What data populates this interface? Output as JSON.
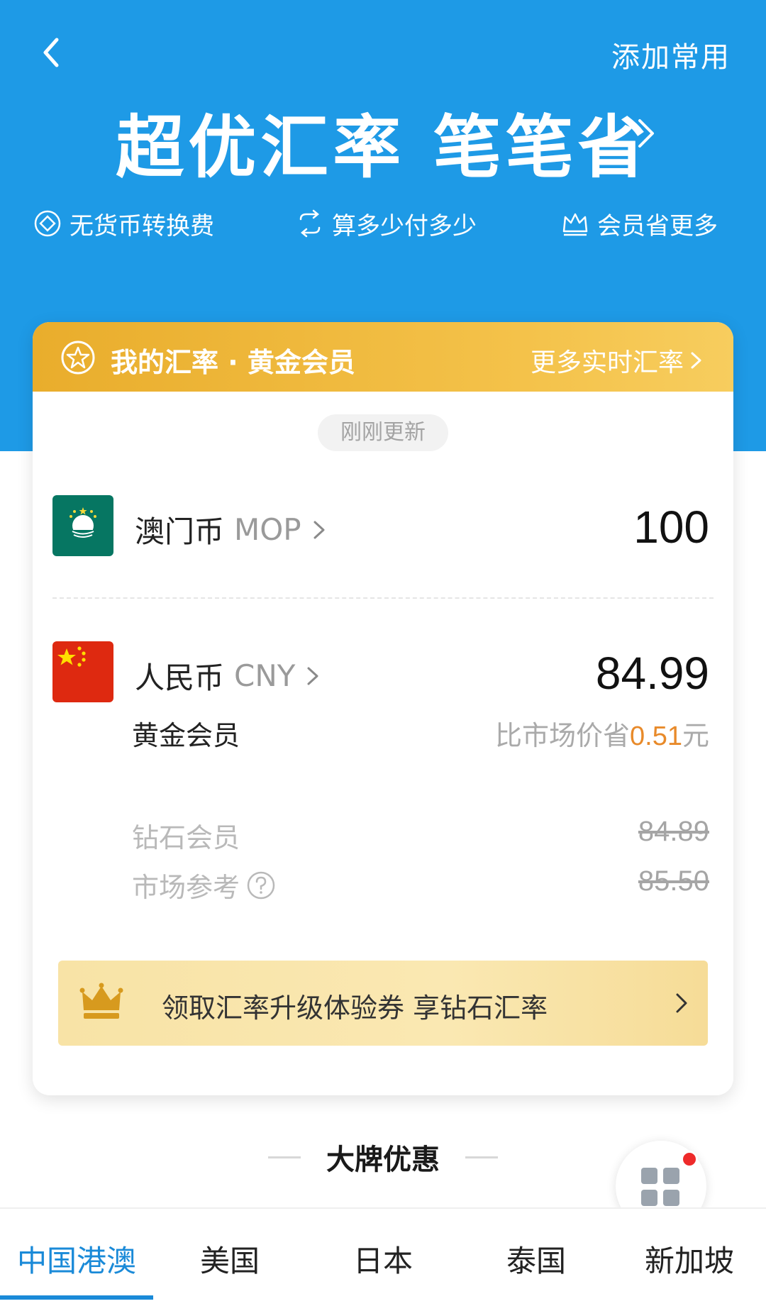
{
  "header": {
    "add_common": "添加常用",
    "title": "超优汇率 笔笔省",
    "features": [
      {
        "label": "无货币转换费",
        "icon": "coin-exchange-icon"
      },
      {
        "label": "算多少付多少",
        "icon": "swap-arrows-icon"
      },
      {
        "label": "会员省更多",
        "icon": "crown-outline-icon"
      }
    ]
  },
  "rate_card": {
    "title": "我的汇率 · 黄金会员",
    "more_link": "更多实时汇率",
    "updated": "刚刚更新",
    "source": {
      "name": "澳门币",
      "code": "MOP",
      "amount": "100"
    },
    "target": {
      "name": "人民币",
      "code": "CNY",
      "amount": "84.99"
    },
    "gold": {
      "label": "黄金会员",
      "saving_prefix": "比市场价省",
      "saving_amount": "0.51",
      "saving_unit": "元"
    },
    "diamond": {
      "label": "钻石会员",
      "value": "84.89"
    },
    "market": {
      "label": "市场参考",
      "value": "85.50"
    }
  },
  "promo": {
    "text": "领取汇率升级体验券 享钻石汇率"
  },
  "section": {
    "title": "大牌优惠"
  },
  "tabs": [
    {
      "label": "中国港澳",
      "active": true
    },
    {
      "label": "美国",
      "active": false
    },
    {
      "label": "日本",
      "active": false
    },
    {
      "label": "泰国",
      "active": false
    },
    {
      "label": "新加坡",
      "active": false
    }
  ],
  "colors": {
    "hero_blue": "#1e9ae6",
    "gold_header": "#f0b83a",
    "saving_orange": "#e88a2a",
    "tab_active": "#1a8ad8",
    "badge_red": "#ee2a2a"
  }
}
